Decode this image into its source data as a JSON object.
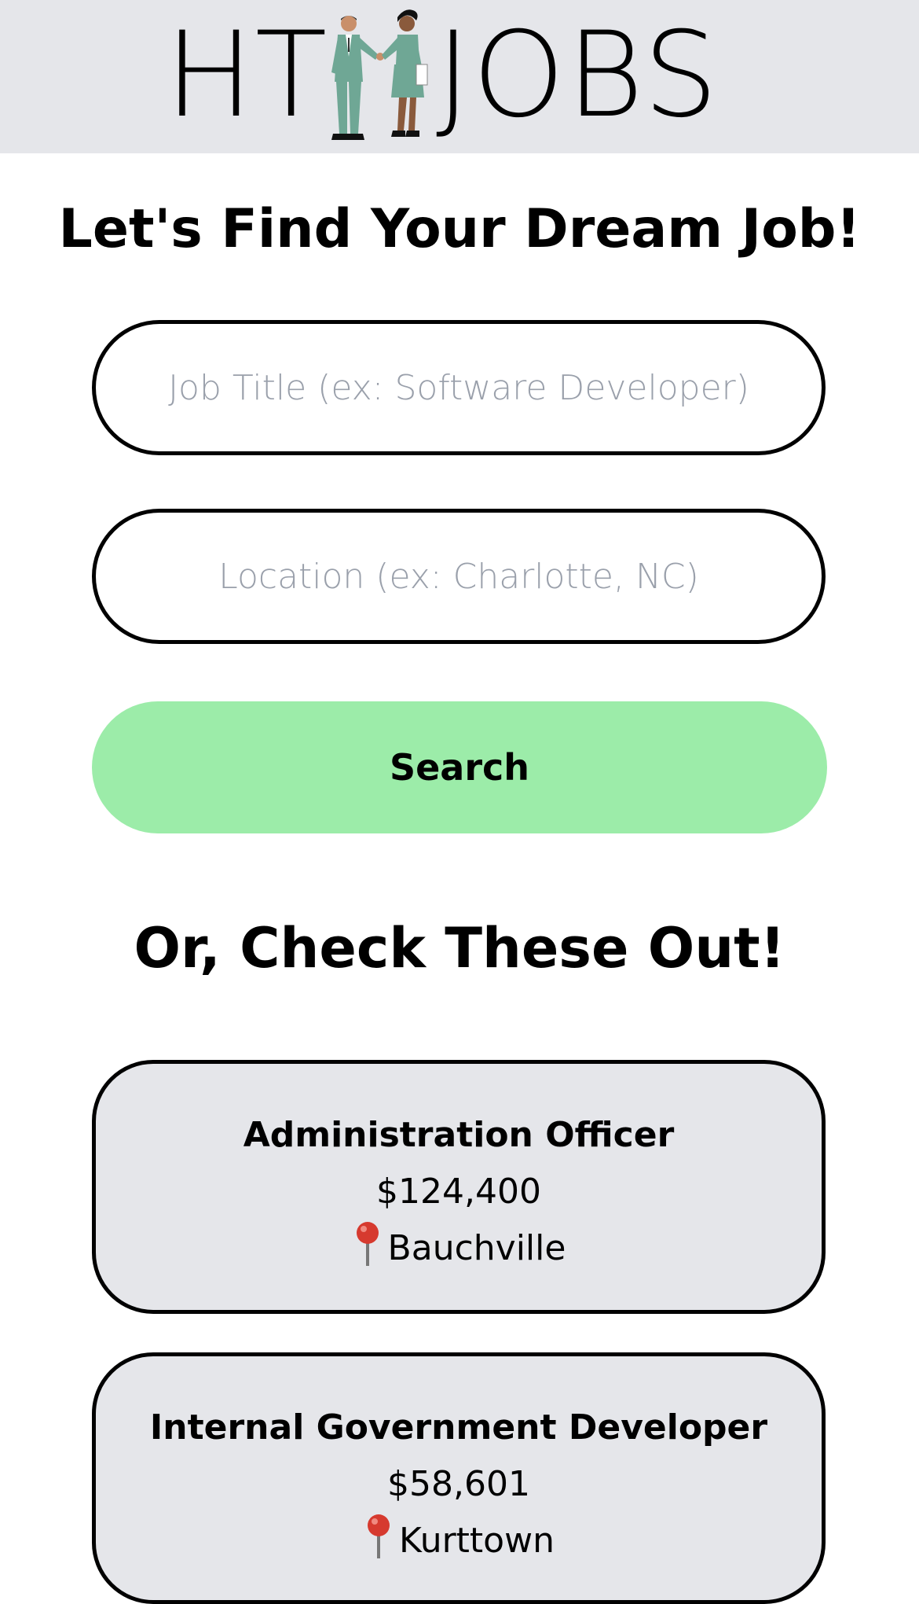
{
  "header": {
    "logo_left": "HT",
    "logo_right": "JOBS",
    "logo_figures_icon": "handshake-people-icon"
  },
  "search": {
    "heading": "Let's Find Your Dream Job!",
    "job_title_placeholder": "Job Title (ex: Software Developer)",
    "job_title_value": "",
    "location_placeholder": "Location (ex: Charlotte, NC)",
    "location_value": "",
    "button_label": "Search"
  },
  "featured": {
    "heading": "Or, Check These Out!",
    "jobs": [
      {
        "title": "Administration Officer",
        "salary": "$124,400",
        "location": "Bauchville",
        "icon": "pin-icon"
      },
      {
        "title": "Internal Government Developer",
        "salary": "$58,601",
        "location": "Kurttown",
        "icon": "pin-icon"
      }
    ]
  },
  "colors": {
    "header_bg": "#e5e6ea",
    "button_bg": "#9ceca9",
    "card_bg": "#e5e6ea",
    "figure_suit": "#6fa795",
    "pin_red": "#d63a2f"
  }
}
